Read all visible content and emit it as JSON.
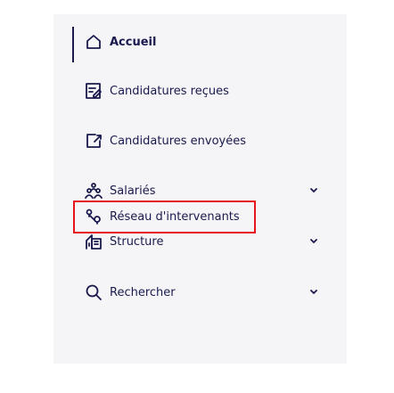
{
  "nav": {
    "items": [
      {
        "label": "Accueil",
        "icon": "home-icon",
        "active": true,
        "has_submenu": false
      },
      {
        "label": "Candidatures reçues",
        "icon": "inbox-edit-icon",
        "active": false,
        "has_submenu": false
      },
      {
        "label": "Candidatures envoyées",
        "icon": "send-box-icon",
        "active": false,
        "has_submenu": false
      },
      {
        "label": "Salariés",
        "icon": "group-icon",
        "active": false,
        "has_submenu": true
      },
      {
        "label": "Réseau d'intervenants",
        "icon": "network-pins-icon",
        "active": false,
        "has_submenu": false,
        "highlighted": true
      },
      {
        "label": "Structure",
        "icon": "building-icon",
        "active": false,
        "has_submenu": true
      },
      {
        "label": "Rechercher",
        "icon": "search-icon",
        "active": false,
        "has_submenu": true
      }
    ]
  },
  "colors": {
    "text": "#1a1a4e",
    "sidebar_bg": "#f5f5f7",
    "highlight": "#e8141c"
  }
}
